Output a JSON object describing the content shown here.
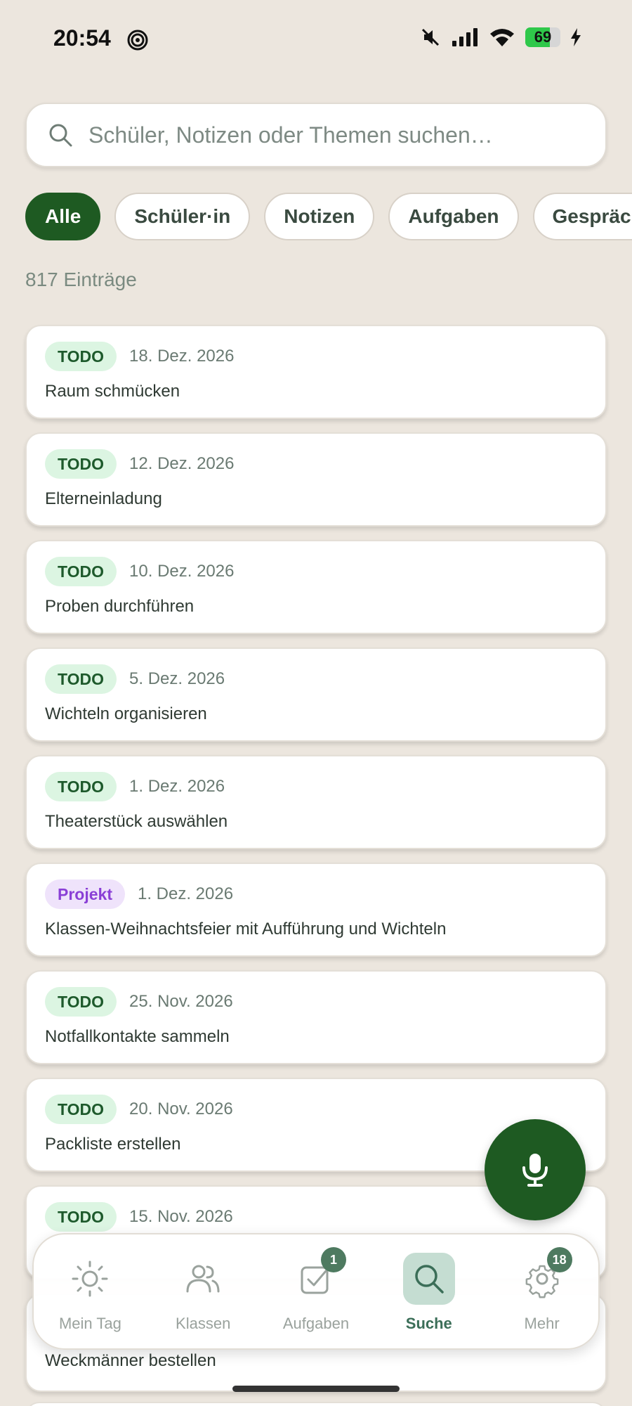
{
  "status_bar": {
    "time": "20:54",
    "battery_level": "69",
    "battery_fraction": 0.69,
    "icons": [
      "spiral-icon",
      "mute-icon",
      "signal-icon",
      "wifi-icon",
      "battery-icon",
      "charging-icon"
    ]
  },
  "search": {
    "placeholder": "Schüler, Notizen oder Themen suchen…",
    "value": ""
  },
  "filters": [
    {
      "label": "Alle",
      "active": true
    },
    {
      "label": "Schüler·in",
      "active": false
    },
    {
      "label": "Notizen",
      "active": false
    },
    {
      "label": "Aufgaben",
      "active": false
    },
    {
      "label": "Gespräche",
      "active": false
    }
  ],
  "results": {
    "count_label": "817 Einträge",
    "items": [
      {
        "type": "TODO",
        "date": "18. Dez. 2026",
        "title": "Raum schmücken"
      },
      {
        "type": "TODO",
        "date": "12. Dez. 2026",
        "title": "Elterneinladung"
      },
      {
        "type": "TODO",
        "date": "10. Dez. 2026",
        "title": "Proben durchführen"
      },
      {
        "type": "TODO",
        "date": "5. Dez. 2026",
        "title": "Wichteln organisieren"
      },
      {
        "type": "TODO",
        "date": "1. Dez. 2026",
        "title": "Theaterstück auswählen"
      },
      {
        "type": "Projekt",
        "date": "1. Dez. 2026",
        "title": "Klassen-Weihnachtsfeier mit Aufführung und Wichteln"
      },
      {
        "type": "TODO",
        "date": "25. Nov. 2026",
        "title": "Notfallkontakte sammeln"
      },
      {
        "type": "TODO",
        "date": "20. Nov. 2026",
        "title": "Packliste erstellen"
      },
      {
        "type": "TODO",
        "date": "15. Nov. 2026",
        "title": ""
      }
    ],
    "peek_title": "Weckmänner bestellen"
  },
  "fab": {
    "icon": "microphone-icon"
  },
  "colors": {
    "accent": "#1e5a22",
    "background": "#ece6de",
    "todo_badge_bg": "#dcf5e2",
    "projekt_badge_bg": "#efe3fb",
    "projekt_badge_text": "#8a3fd6"
  },
  "bottom_nav": [
    {
      "label": "Mein Tag",
      "icon": "sun-icon",
      "badge": null,
      "active": false
    },
    {
      "label": "Klassen",
      "icon": "users-icon",
      "badge": null,
      "active": false
    },
    {
      "label": "Aufgaben",
      "icon": "checkbox-icon",
      "badge": "1",
      "active": false
    },
    {
      "label": "Suche",
      "icon": "search-icon",
      "badge": null,
      "active": true
    },
    {
      "label": "Mehr",
      "icon": "gear-icon",
      "badge": "18",
      "active": false
    }
  ]
}
